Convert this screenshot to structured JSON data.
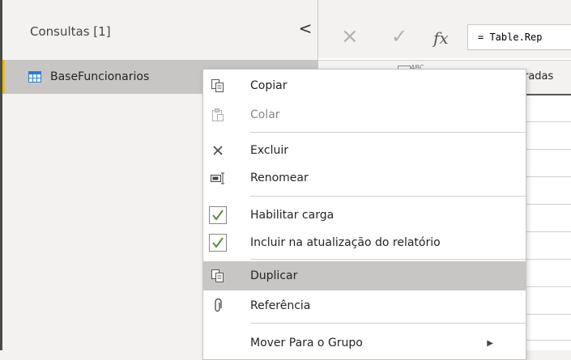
{
  "queries_pane": {
    "header": "Consultas [1]",
    "collapse_glyph": "<",
    "items": [
      {
        "label": "BaseFuncionarios",
        "icon": "table-icon"
      }
    ]
  },
  "formula_bar": {
    "cancel_glyph": "×",
    "confirm_glyph": "✓",
    "fx_label": "fx",
    "formula_text": "= Table.Rep"
  },
  "grid": {
    "type_badge": "ABC",
    "column_header_partial": "eradas"
  },
  "context_menu": {
    "items": [
      {
        "label": "Copiar",
        "icon": "copy-icon",
        "enabled": true
      },
      {
        "label": "Colar",
        "icon": "paste-icon",
        "enabled": false
      },
      {
        "label": "Excluir",
        "icon": "delete-icon",
        "enabled": true
      },
      {
        "label": "Renomear",
        "icon": "rename-icon",
        "enabled": true
      },
      {
        "label": "Habilitar carga",
        "icon": "checkbox-icon",
        "checked": true
      },
      {
        "label": "Incluir na atualização do relatório",
        "icon": "checkbox-icon",
        "checked": true
      },
      {
        "label": "Duplicar",
        "icon": "duplicate-icon",
        "highlighted": true
      },
      {
        "label": "Referência",
        "icon": "reference-icon",
        "enabled": true
      },
      {
        "label": "Mover Para o Grupo",
        "icon": "",
        "submenu": true
      }
    ],
    "submenu_glyph": "▶"
  },
  "colors": {
    "accent_yellow": "#e8b91e",
    "selected_bg": "#c8c6c4",
    "check_green": "#5b8c3a",
    "table_icon_blue": "#2b7cd3"
  }
}
